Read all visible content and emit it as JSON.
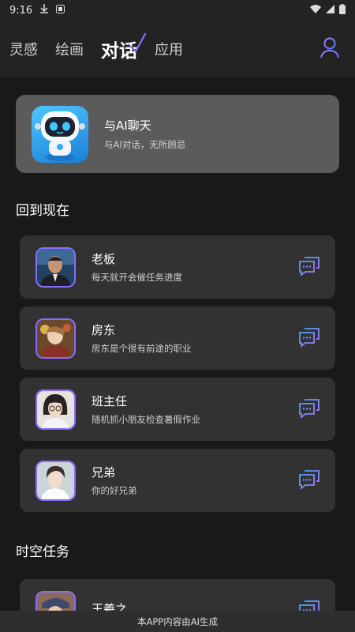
{
  "status_bar": {
    "time": "9:16"
  },
  "nav": {
    "tabs": [
      {
        "label": "灵感"
      },
      {
        "label": "绘画"
      },
      {
        "label": "对话"
      },
      {
        "label": "应用"
      }
    ],
    "active_tab": "对话",
    "accent_color": "#8c6bff"
  },
  "ai_card": {
    "title": "与AI聊天",
    "subtitle": "与AI对话，无所顾忌"
  },
  "sections": {
    "present": {
      "title": "回到现在",
      "items": [
        {
          "name": "老板",
          "desc": "每天就开会催任务进度"
        },
        {
          "name": "房东",
          "desc": "房东是个很有前途的职业"
        },
        {
          "name": "班主任",
          "desc": "随机抓小朋友检查暑假作业"
        },
        {
          "name": "兄弟",
          "desc": "你的好兄弟"
        }
      ]
    },
    "time_tasks": {
      "title": "时空任务",
      "items": [
        {
          "name": "王羲之"
        }
      ]
    }
  },
  "footer": {
    "text": "本APP内容由AI生成"
  }
}
